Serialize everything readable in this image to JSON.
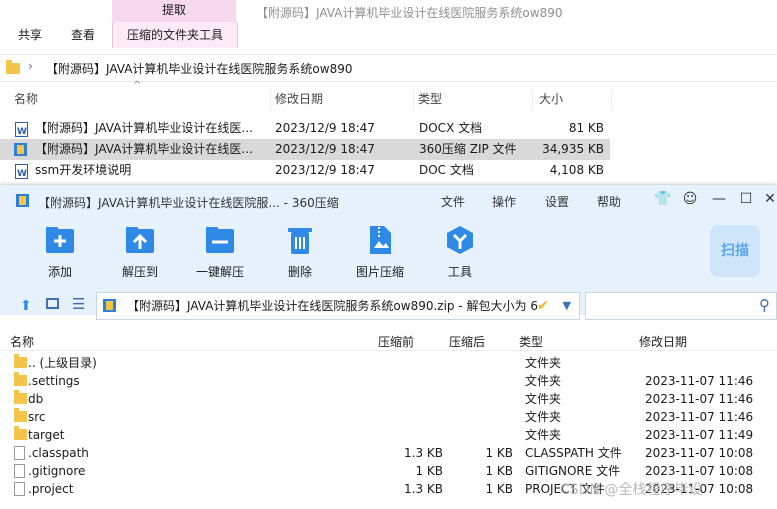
{
  "explorer": {
    "context_tab_head": "提取",
    "tabs": [
      "共享",
      "查看",
      "压缩的文件夹工具"
    ],
    "window_title": "【附源码】JAVA计算机毕业设计在线医院服务系统ow890",
    "address": "【附源码】JAVA计算机毕业设计在线医院服务系统ow890",
    "address_sep": "›",
    "columns": {
      "name": "名称",
      "modified": "修改日期",
      "type": "类型",
      "size": "大小"
    },
    "files": [
      {
        "name": "【附源码】JAVA计算机毕业设计在线医...",
        "modified": "2023/12/9 18:47",
        "type": "DOCX 文档",
        "size": "81 KB"
      },
      {
        "name": "【附源码】JAVA计算机毕业设计在线医...",
        "modified": "2023/12/9 18:47",
        "type": "360压缩 ZIP 文件",
        "size": "34,935 KB"
      },
      {
        "name": "ssm开发环境说明",
        "modified": "2023/12/9 18:47",
        "type": "DOC 文档",
        "size": "4,108 KB"
      }
    ]
  },
  "zip_window": {
    "title": "【附源码】JAVA计算机毕业设计在线医院服... - 360压缩",
    "menu": [
      "文件",
      "操作",
      "设置",
      "帮助"
    ],
    "toolbar": [
      "添加",
      "解压到",
      "一键解压",
      "删除",
      "图片压缩",
      "工具"
    ],
    "scan_label": "扫描",
    "path": "【附源码】JAVA计算机毕业设计在线医院服务系统ow890.zip - 解包大小为 6",
    "columns": {
      "name": "名称",
      "before": "压缩前",
      "after": "压缩后",
      "type": "类型",
      "modified": "修改日期"
    },
    "rows": [
      {
        "name": ".. (上级目录)",
        "before": "",
        "after": "",
        "type": "文件夹",
        "modified": "",
        "kind": "folder"
      },
      {
        "name": ".settings",
        "before": "",
        "after": "",
        "type": "文件夹",
        "modified": "2023-11-07 11:46",
        "kind": "folder"
      },
      {
        "name": "db",
        "before": "",
        "after": "",
        "type": "文件夹",
        "modified": "2023-11-07 11:46",
        "kind": "folder"
      },
      {
        "name": "src",
        "before": "",
        "after": "",
        "type": "文件夹",
        "modified": "2023-11-07 11:46",
        "kind": "folder"
      },
      {
        "name": "target",
        "before": "",
        "after": "",
        "type": "文件夹",
        "modified": "2023-11-07 11:49",
        "kind": "folder"
      },
      {
        "name": ".classpath",
        "before": "1.3 KB",
        "after": "1 KB",
        "type": "CLASSPATH 文件",
        "modified": "2023-11-07 10:08",
        "kind": "file"
      },
      {
        "name": ".gitignore",
        "before": "1 KB",
        "after": "1 KB",
        "type": "GITIGNORE 文件",
        "modified": "2023-11-07 10:08",
        "kind": "file"
      },
      {
        "name": ".project",
        "before": "1.3 KB",
        "after": "1 KB",
        "type": "PROJECT 文件",
        "modified": "2023-11-07 10:08",
        "kind": "file"
      }
    ]
  },
  "watermark": "CSDN @全栈程序毕设",
  "colors": {
    "context_tab": "#f7d9ee",
    "zip_toolbar_bg": "#e6f1fc",
    "icon_blue": "#2e8ae6",
    "folder": "#f3c64b"
  }
}
